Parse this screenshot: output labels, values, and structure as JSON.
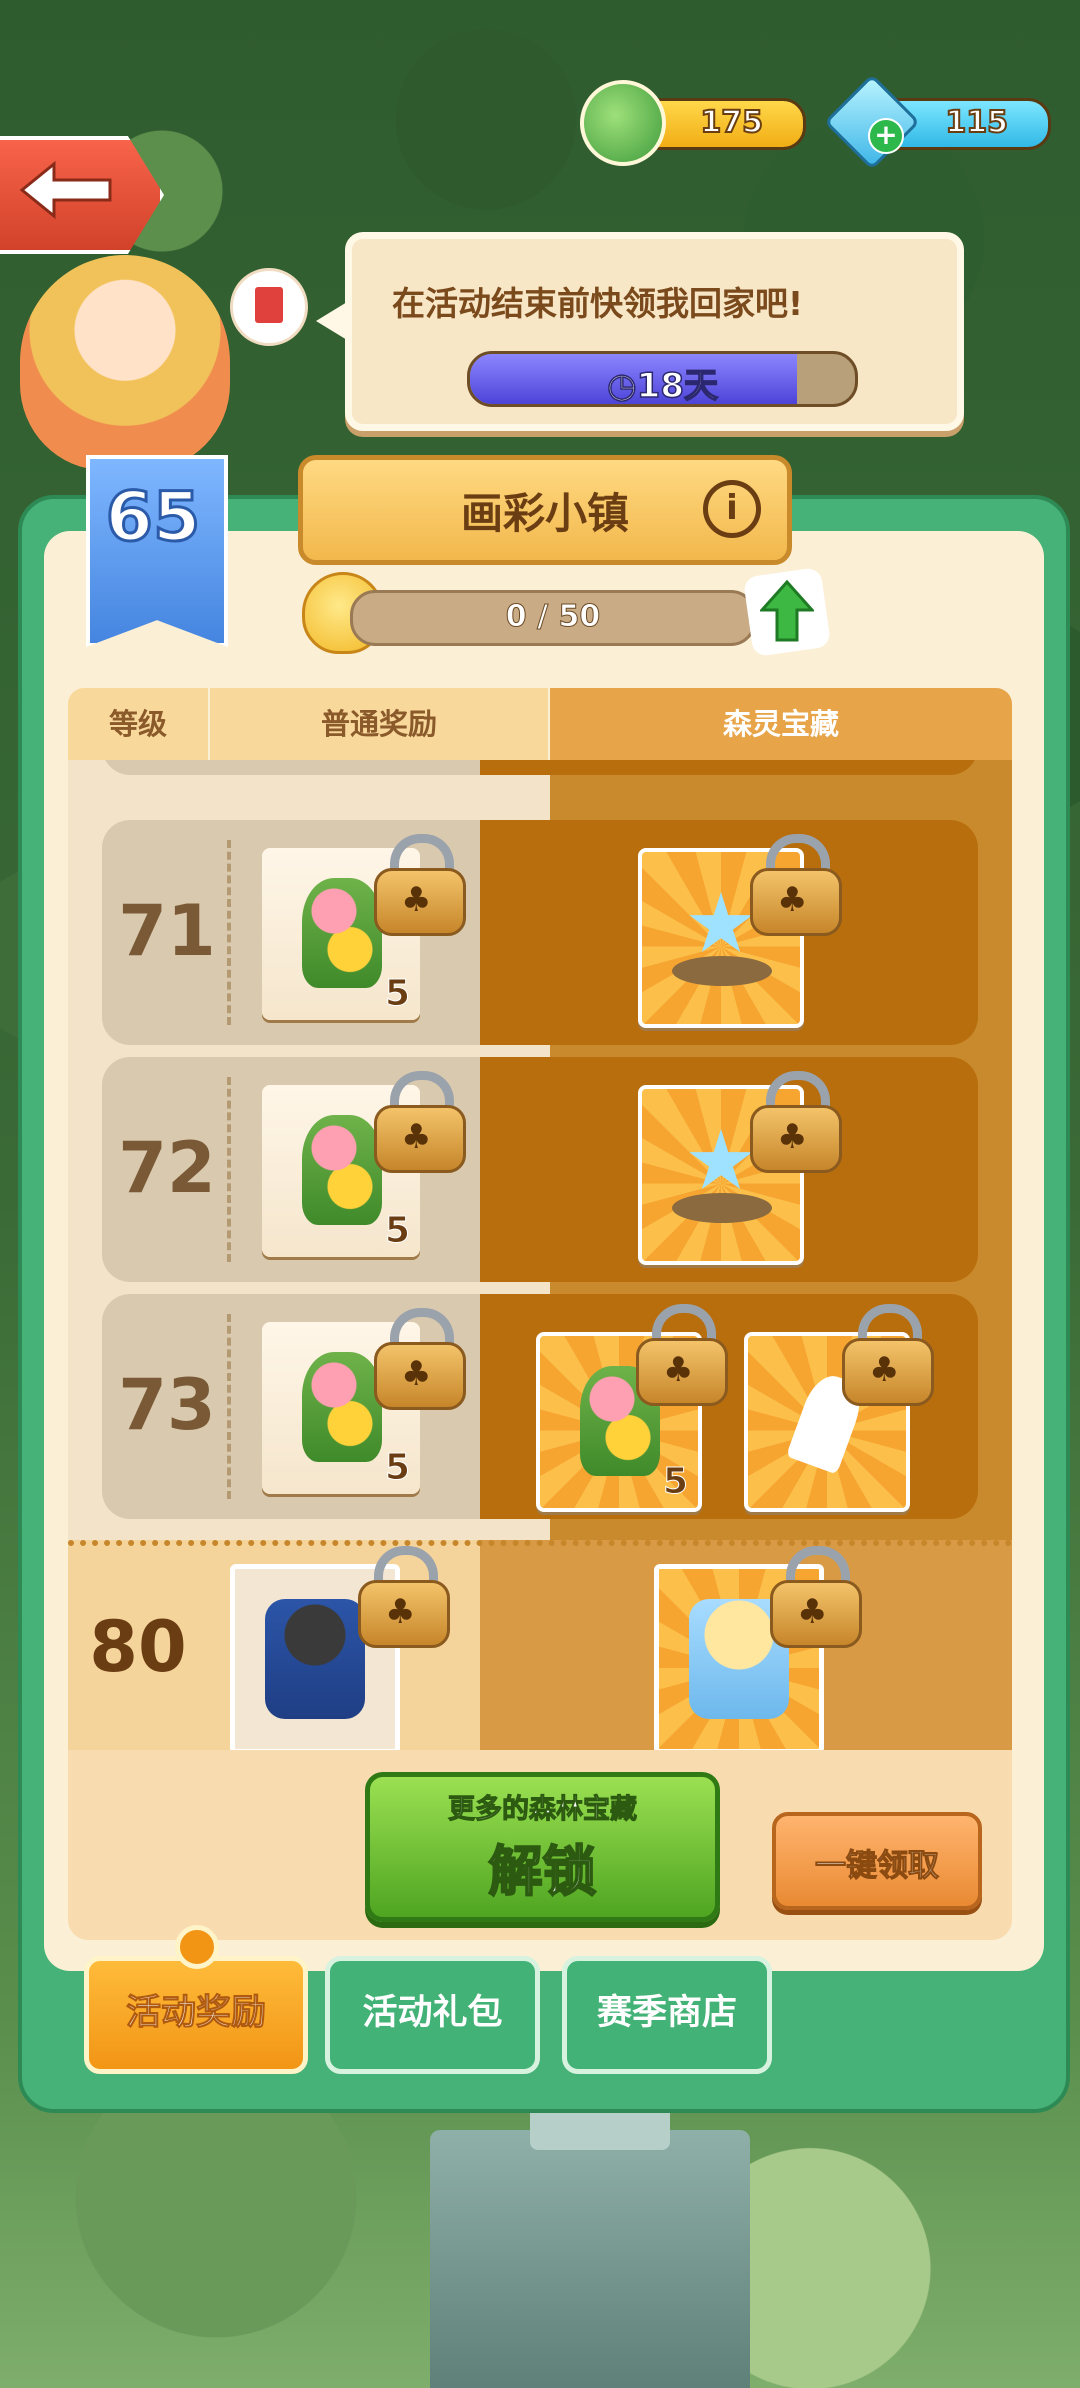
{
  "currency": {
    "coins": "175",
    "gems": "115"
  },
  "event_banner": {
    "message": "在活动结束前快领我回家吧!",
    "time_remaining": "18天",
    "timer_fill_fraction": 0.85
  },
  "player": {
    "level": "65"
  },
  "event": {
    "title": "画彩小镇",
    "progress_text": "0 / 50"
  },
  "table": {
    "headers": {
      "level": "等级",
      "normal": "普通奖励",
      "treasure": "森灵宝藏"
    },
    "rows": [
      {
        "level": "71",
        "normal": {
          "item": "flower-plant",
          "qty": "5",
          "locked": true
        },
        "treasure": [
          {
            "item": "blue-star-rock",
            "qty": "",
            "locked": true
          }
        ]
      },
      {
        "level": "72",
        "normal": {
          "item": "flower-plant",
          "qty": "5",
          "locked": true
        },
        "treasure": [
          {
            "item": "blue-star-rock",
            "qty": "",
            "locked": true
          }
        ]
      },
      {
        "level": "73",
        "normal": {
          "item": "flower-plant",
          "qty": "5",
          "locked": true
        },
        "treasure": [
          {
            "item": "flower-garden-tile",
            "qty": "5",
            "locked": true
          },
          {
            "item": "broom",
            "qty": "",
            "locked": true
          }
        ]
      }
    ],
    "final_row": {
      "level": "80",
      "normal": {
        "item": "dark-dog-basket",
        "locked": true
      },
      "treasure": {
        "item": "golden-dog-basket",
        "locked": true
      }
    }
  },
  "buttons": {
    "unlock_sub": "更多的森林宝藏",
    "unlock_main": "解锁",
    "claim_all": "一键领取"
  },
  "tabs": {
    "rewards": "活动奖励",
    "gift_pack": "活动礼包",
    "season_shop": "赛季商店"
  },
  "colors": {
    "panel_green": "#46b277",
    "timer_purple": "#4d44d8",
    "unlock_green": "#4fa521",
    "claim_orange": "#e98a33"
  }
}
